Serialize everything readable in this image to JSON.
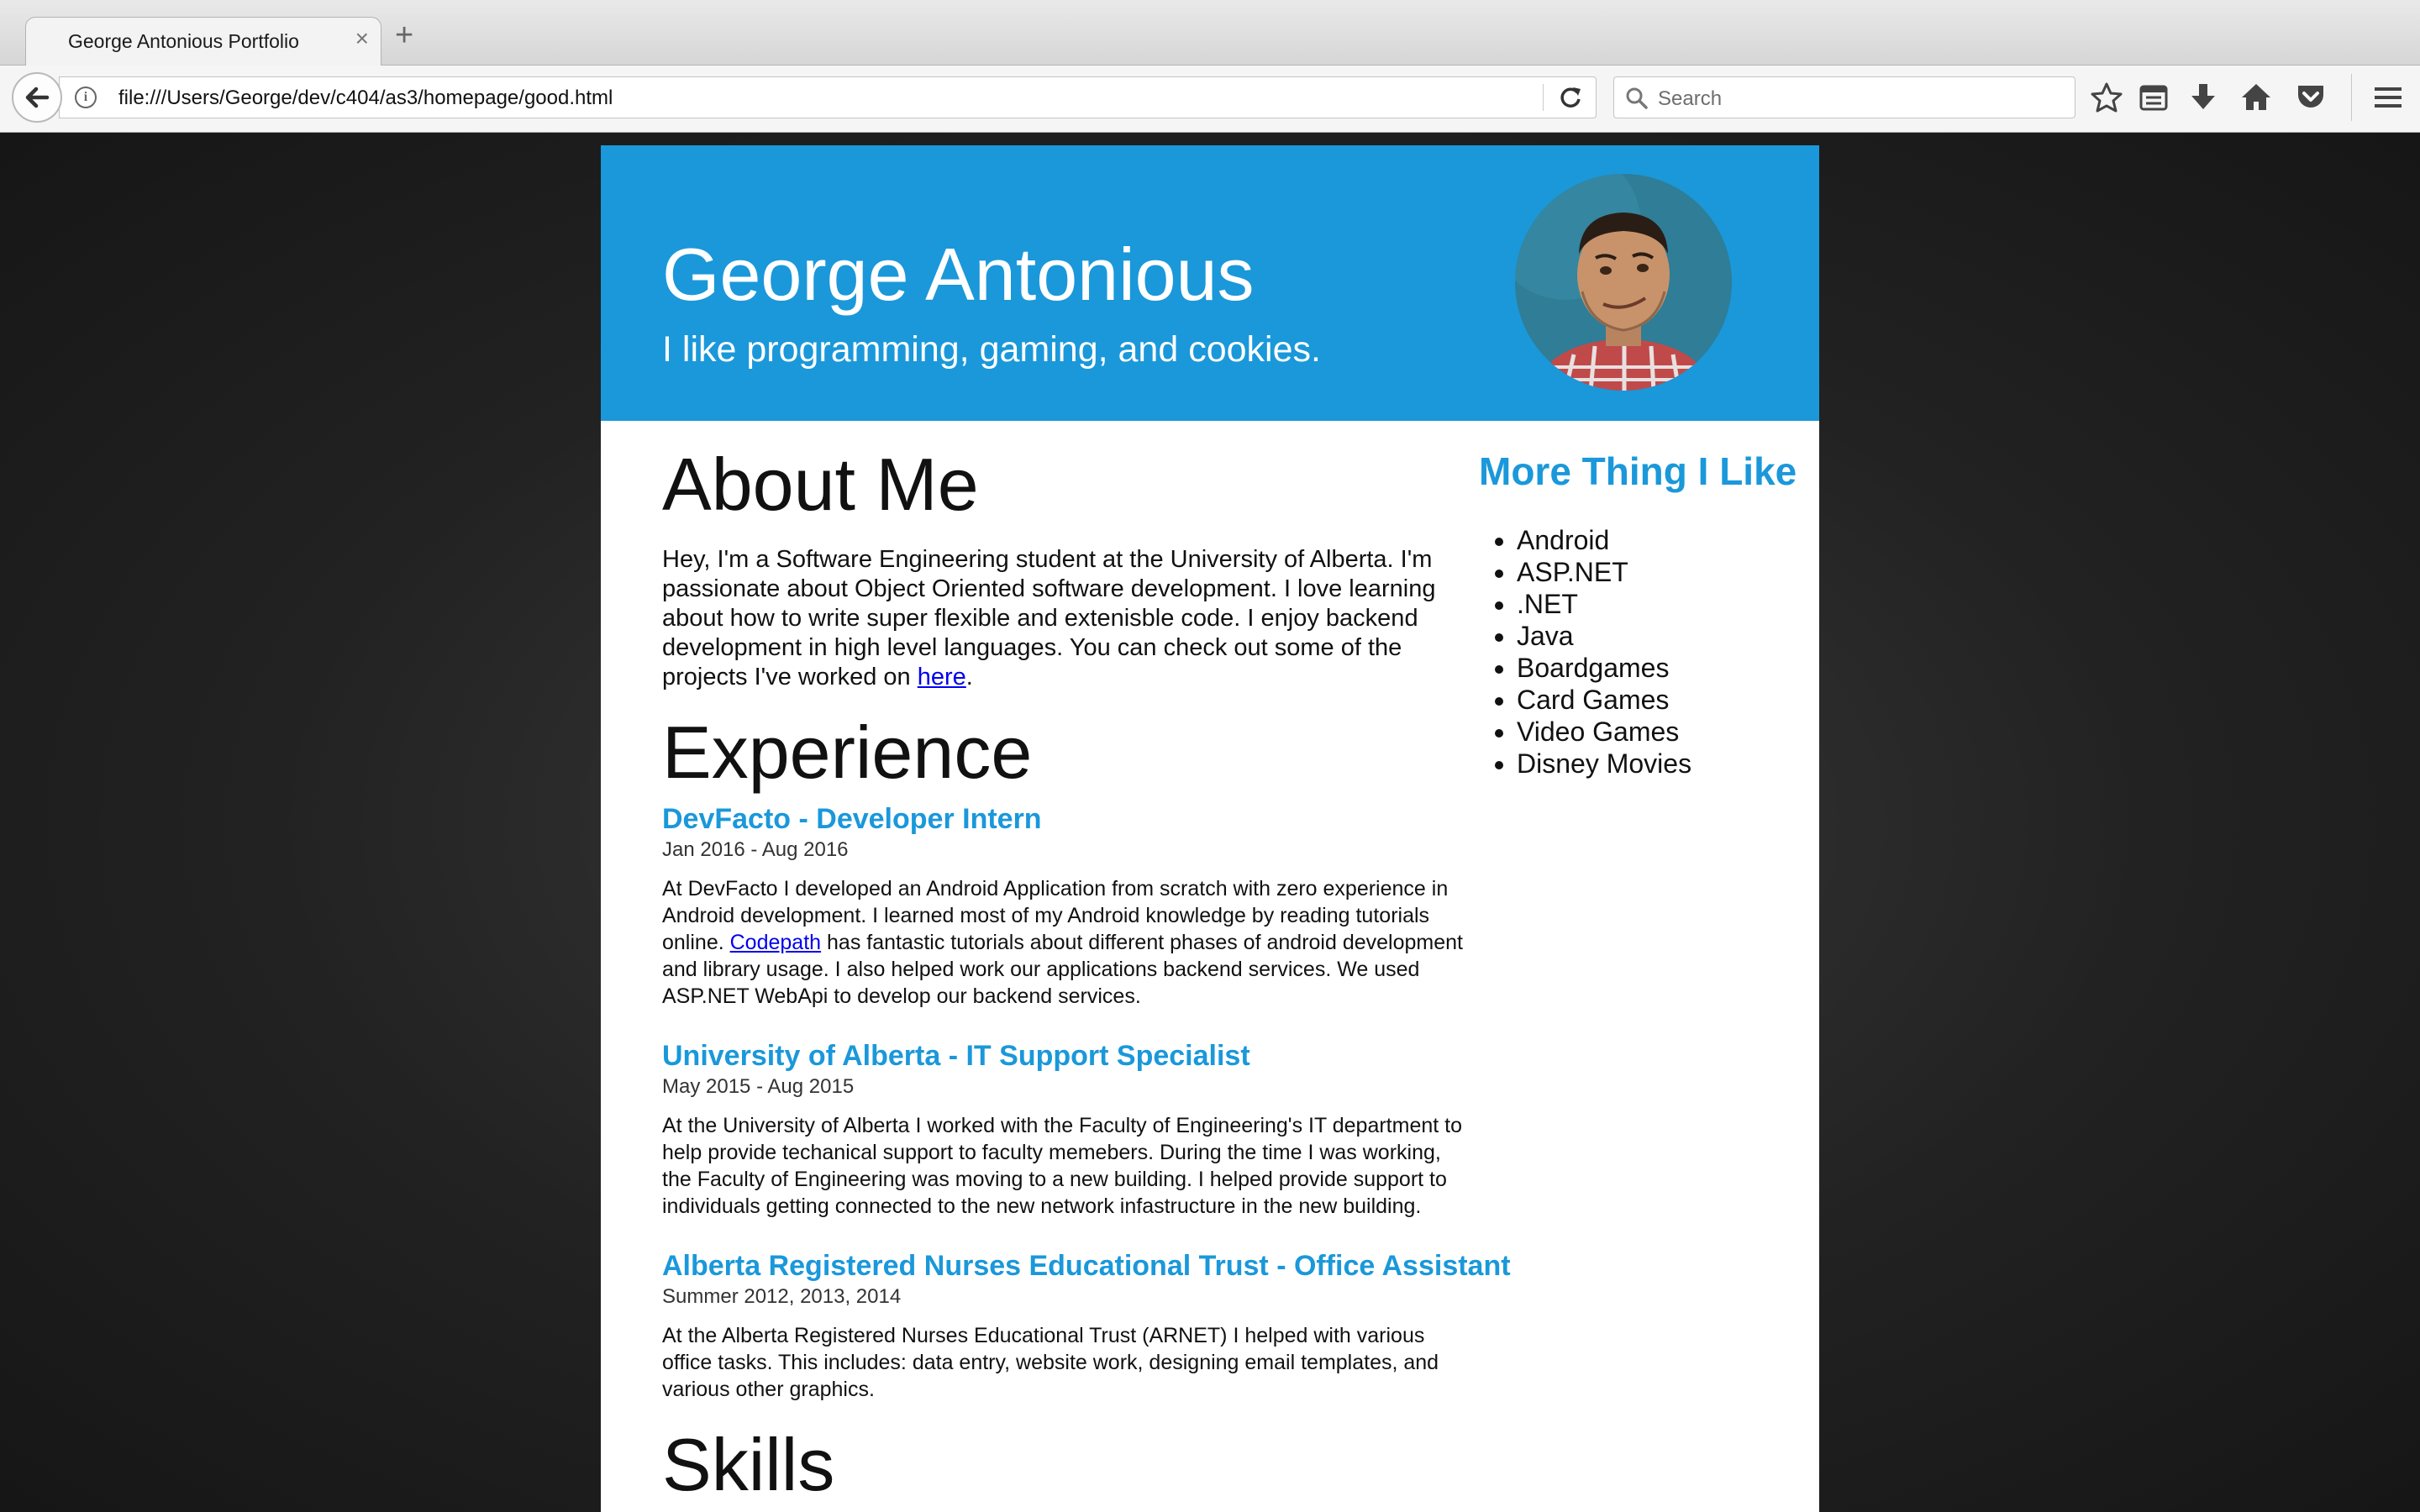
{
  "browser": {
    "tab_title": "George Antonious Portfolio",
    "tab_close": "×",
    "new_tab": "+",
    "url": "file:///Users/George/dev/c404/as3/homepage/good.html",
    "search_placeholder": "Search"
  },
  "hero": {
    "name": "George Antonious",
    "tagline": "I like programming, gaming, and cookies."
  },
  "about": {
    "heading": "About Me",
    "text_before_link": "Hey, I'm a Software Engineering student at the University of Alberta. I'm passionate about Object Oriented software development. I love learning about how to write super flexible and extenisble code. I enjoy backend development in high level languages. You can check out some of the projects I've worked on ",
    "link_text": "here",
    "text_after_link": "."
  },
  "experience": {
    "heading": "Experience",
    "jobs": [
      {
        "title": "DevFacto - Developer Intern",
        "date": "Jan 2016 - Aug 2016",
        "desc_before_link": "At DevFacto I developed an Android Application from scratch with zero experience in Android development. I learned most of my Android knowledge by reading tutorials online. ",
        "link_text": "Codepath",
        "desc_after_link": " has fantastic tutorials about different phases of android development and library usage. I also helped work our applications backend services. We used ASP.NET WebApi to develop our backend services."
      },
      {
        "title": "University of Alberta - IT Support Specialist",
        "date": "May 2015 - Aug 2015",
        "desc": "At the University of Alberta I worked with the Faculty of Engineering's IT department to help provide techanical support to faculty memebers. During the time I was working, the Faculty of Engineering was moving to a new building. I helped provide support to individuals getting connected to the new network infastructure in the new building."
      },
      {
        "title": "Alberta Registered Nurses Educational Trust - Office Assistant",
        "date": "Summer 2012, 2013, 2014",
        "desc": "At the Alberta Registered Nurses Educational Trust (ARNET) I helped with various office tasks. This includes: data entry, website work, designing email templates, and various other graphics."
      }
    ]
  },
  "skills": {
    "heading": "Skills"
  },
  "sidebar": {
    "title": "More Thing I Like",
    "items": [
      "Android",
      "ASP.NET",
      ".NET",
      "Java",
      "Boardgames",
      "Card Games",
      "Video Games",
      "Disney Movies"
    ]
  },
  "colors": {
    "accent": "#1a98da",
    "link": "#0000ee"
  }
}
